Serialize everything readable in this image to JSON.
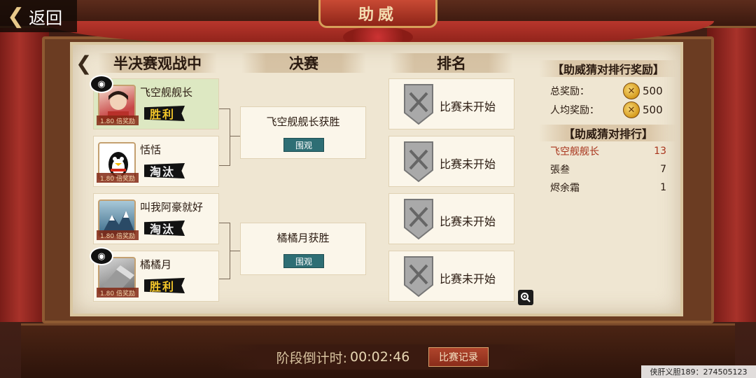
{
  "header": {
    "back_label": "返回",
    "title": "助威"
  },
  "columns": {
    "semifinal": "半决赛观战中",
    "final": "决赛",
    "ranking": "排名"
  },
  "players": [
    {
      "name": "飞空舰舰长",
      "odds": "1.80 倍奖励",
      "result": "胜利",
      "status": "win",
      "bet": true
    },
    {
      "name": "恬恬",
      "odds": "1.80 倍奖励",
      "result": "淘汰",
      "status": "lose",
      "bet": false
    },
    {
      "name": "叫我阿豪就好",
      "odds": "1.80 倍奖励",
      "result": "淘汰",
      "status": "lose",
      "bet": false
    },
    {
      "name": "橘橘月",
      "odds": "1.80 倍奖励",
      "result": "胜利",
      "status": "win",
      "bet": true
    }
  ],
  "finals": [
    {
      "text": "飞空舰舰长获胜",
      "button": "围观"
    },
    {
      "text": "橘橘月获胜",
      "button": "围观"
    }
  ],
  "ranking_slots": [
    "比赛未开始",
    "比赛未开始",
    "比赛未开始",
    "比赛未开始"
  ],
  "rewards": {
    "title": "【助威猜对排行奖励】",
    "total_label": "总奖励：",
    "total_value": "500",
    "avg_label": "人均奖励：",
    "avg_value": "500"
  },
  "leaderboard": {
    "title": "【助威猜对排行】",
    "rows": [
      {
        "name": "飞空舰舰长",
        "score": "13"
      },
      {
        "name": "張叁",
        "score": "7"
      },
      {
        "name": "烬余霜",
        "score": "1"
      }
    ]
  },
  "footer": {
    "countdown_label": "阶段倒计时:",
    "countdown_value": "00:02:46",
    "record_button": "比赛记录"
  },
  "watermark": "侠肝义胆189：274505123",
  "colors": {
    "win_text": "#f3c62a",
    "win_card": "#dde8c2",
    "top_rank": "#a8341c",
    "watch_button": "#2e6e74"
  }
}
